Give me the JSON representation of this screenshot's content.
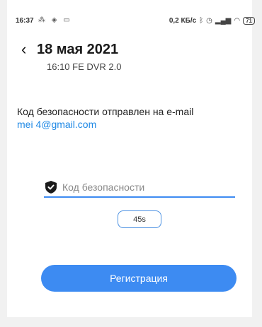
{
  "status_bar": {
    "time": "16:37",
    "left_icons": "⁂ ◈ ▭",
    "speed": "0,2 КБ/с",
    "right_icons": [
      "bluetooth-icon",
      "alarm-icon",
      "signal-icon",
      "wifi-icon"
    ],
    "battery": "71"
  },
  "header": {
    "back_icon": "chevron-left-icon",
    "title": "18 мая 2021",
    "subtitle": "16:10 FE DVR 2.0"
  },
  "message": {
    "text": "Код безопасности отправлен на e-mail",
    "email": "mei    4@gmail.com"
  },
  "code_field": {
    "icon": "shield-check-icon",
    "placeholder": "Код безопасности",
    "value": ""
  },
  "timer": {
    "label": "45s"
  },
  "register_button": {
    "label": "Регистрация"
  },
  "colors": {
    "accent": "#3d8bf2",
    "link": "#1e88e5",
    "frame": "#f1f1f1"
  }
}
